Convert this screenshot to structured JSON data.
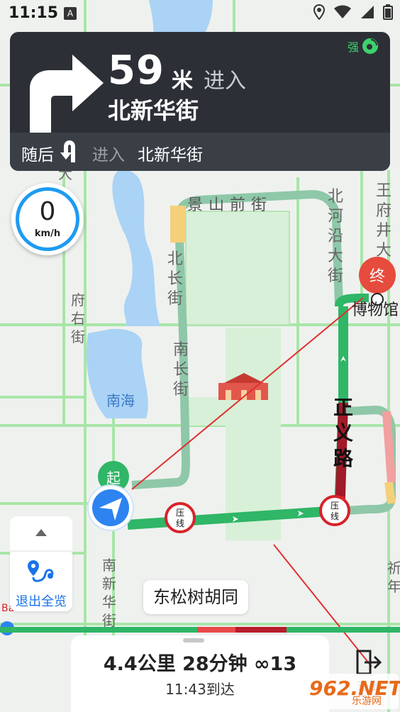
{
  "status_bar": {
    "time": "11:15",
    "a_label": "A"
  },
  "guidance": {
    "distance": "59",
    "unit": "米",
    "action": "进入",
    "road": "北新华街",
    "gps_label": "强",
    "then_label": "随后",
    "next_action": "进入",
    "next_road": "北新华街"
  },
  "speed": {
    "value": "0",
    "unit": "km/h"
  },
  "map_labels": {
    "jingshan": "景山前街",
    "beihe": "北河沿大街",
    "wangfujing": "王府井大",
    "fuyou": "府右街",
    "beichang": "北长街",
    "nanchang": "南长街",
    "nanhai": "南海",
    "zhengyi": "正义路",
    "bowuguan": "博物馆",
    "nanxinhua": "南新华街",
    "qinian": "祈年",
    "da": "大",
    "start": "起",
    "end": "终",
    "press_line": "压线",
    "ba": "Ba"
  },
  "controls": {
    "overview_label": "退出全览"
  },
  "current_road": "东松树胡同",
  "trip": {
    "stats": "4.4公里 28分钟 ∞13",
    "arrive": "11:43到达"
  },
  "exit": {
    "label": "退出"
  },
  "watermark": {
    "main": "962.NET",
    "sub": "乐游网"
  },
  "colors": {
    "route_green": "#2fb667",
    "route_red": "#d8232a",
    "panel": "#2c3036",
    "accent_blue": "#1e9bf0"
  }
}
